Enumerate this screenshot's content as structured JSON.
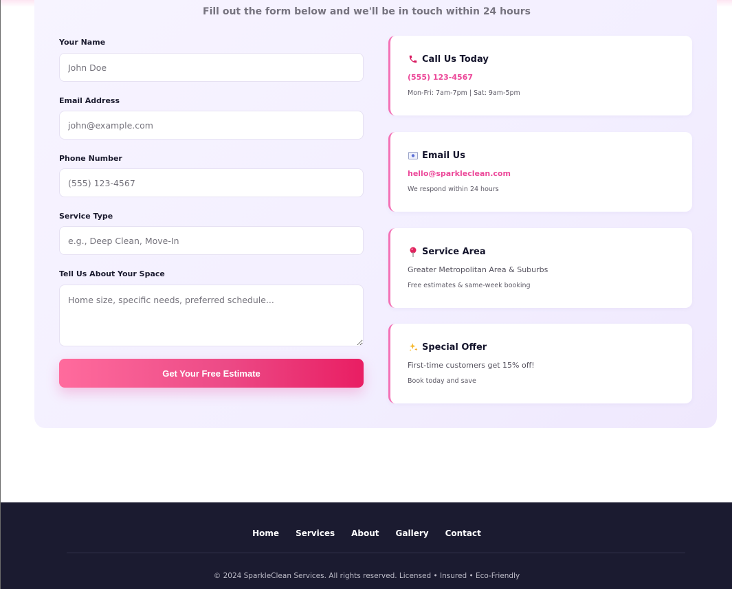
{
  "header": {
    "subtitle": "Fill out the form below and we'll be in touch within 24 hours"
  },
  "form": {
    "name": {
      "label": "Your Name",
      "placeholder": "John Doe"
    },
    "email": {
      "label": "Email Address",
      "placeholder": "john@example.com"
    },
    "phone": {
      "label": "Phone Number",
      "placeholder": "(555) 123-4567"
    },
    "service": {
      "label": "Service Type",
      "placeholder": "e.g., Deep Clean, Move-In"
    },
    "message": {
      "label": "Tell Us About Your Space",
      "placeholder": "Home size, specific needs, preferred schedule..."
    },
    "submit_label": "Get Your Free Estimate"
  },
  "cards": [
    {
      "icon": "phone-icon",
      "title": "Call Us Today",
      "line1": "(555) 123-4567",
      "line2": "Mon-Fri: 7am-7pm | Sat: 9am-5pm"
    },
    {
      "icon": "envelope-icon",
      "title": "Email Us",
      "line1": "hello@sparkleclean.com",
      "line2": "We respond within 24 hours"
    },
    {
      "icon": "map-pin-icon",
      "title": "Service Area",
      "line1": "Greater Metropolitan Area & Suburbs",
      "line2": "Free estimates & same-week booking"
    },
    {
      "icon": "sparkles-icon",
      "title": "Special Offer",
      "line1": "First-time customers get 15% off!",
      "line2": "Book today and save"
    }
  ],
  "footer": {
    "nav": [
      "Home",
      "Services",
      "About",
      "Gallery",
      "Contact"
    ],
    "copyright": "© 2024 SparkleClean Services. All rights reserved. Licensed • Insured • Eco-Friendly"
  },
  "colors": {
    "accent": "#ec4899",
    "button_start": "#ff6b9d",
    "button_end": "#e91e63",
    "footer_bg": "#1b1b30",
    "panel_bg": "#f5f2ff"
  }
}
